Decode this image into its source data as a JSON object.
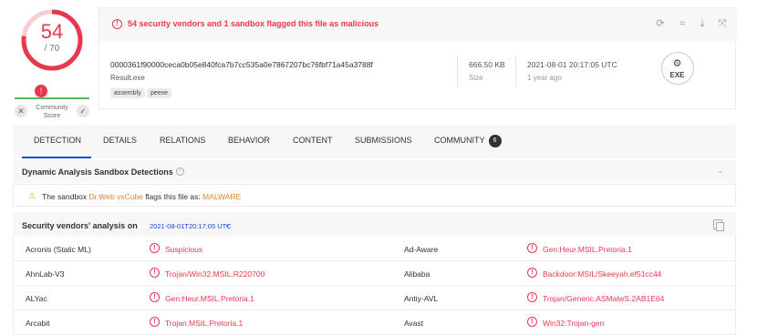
{
  "score": {
    "detections": "54",
    "total": "/ 70",
    "community_label": "Community Score",
    "flag_icon": "alert-icon"
  },
  "alert": {
    "text": "54 security vendors and 1 sandbox flagged this file as malicious"
  },
  "file": {
    "hash": "0000361f90000ceca0b05e840fca7b7cc535a0e7867207bc76fbf71a45a3788f",
    "name": "Result.exe",
    "tags": [
      "assembly",
      "peexe"
    ],
    "size_value": "666.50 KB",
    "size_label": "Size",
    "date_value": "2021-08-01 20:17:05 UTC",
    "date_label": "1 year ago",
    "type_badge": "EXE"
  },
  "toolbar_icons": [
    "reanalyze-icon",
    "similar-icon",
    "download-icon",
    "graph-icon"
  ],
  "tabs": [
    {
      "label": "DETECTION",
      "active": true
    },
    {
      "label": "DETAILS"
    },
    {
      "label": "RELATIONS"
    },
    {
      "label": "BEHAVIOR"
    },
    {
      "label": "CONTENT"
    },
    {
      "label": "SUBMISSIONS"
    },
    {
      "label": "COMMUNITY",
      "badge": "6"
    }
  ],
  "sandbox": {
    "title": "Dynamic Analysis Sandbox Detections",
    "prefix": "The sandbox",
    "name": "Dr.Web vxCube",
    "middle": "flags this file as:",
    "verdict": "MALWARE"
  },
  "vendors": {
    "title": "Security vendors' analysis on",
    "date": "2021-08-01T20:17:05 UTC",
    "rows": [
      {
        "left_name": "Acronis (Static ML)",
        "left_result": "Suspicious",
        "right_name": "Ad-Aware",
        "right_result": "Gen:Heur.MSIL.Pretoria.1"
      },
      {
        "left_name": "AhnLab-V3",
        "left_result": "Trojan/Win32.MSIL.R220700",
        "right_name": "Alibaba",
        "right_result": "Backdoor:MSIL/Skeeyah.ef51cc44"
      },
      {
        "left_name": "ALYac",
        "left_result": "Gen:Heur.MSIL.Pretoria.1",
        "right_name": "Antiy-AVL",
        "right_result": "Trojan/Generic.ASMalwS.2AB1E64"
      },
      {
        "left_name": "Arcabit",
        "left_result": "Trojan.MSIL.Pretoria.1",
        "right_name": "Avast",
        "right_result": "Win32:Trojan-gen"
      }
    ]
  },
  "colors": {
    "malicious": "#e8384f",
    "accent": "#0b4dda",
    "warning": "#e0842a"
  }
}
